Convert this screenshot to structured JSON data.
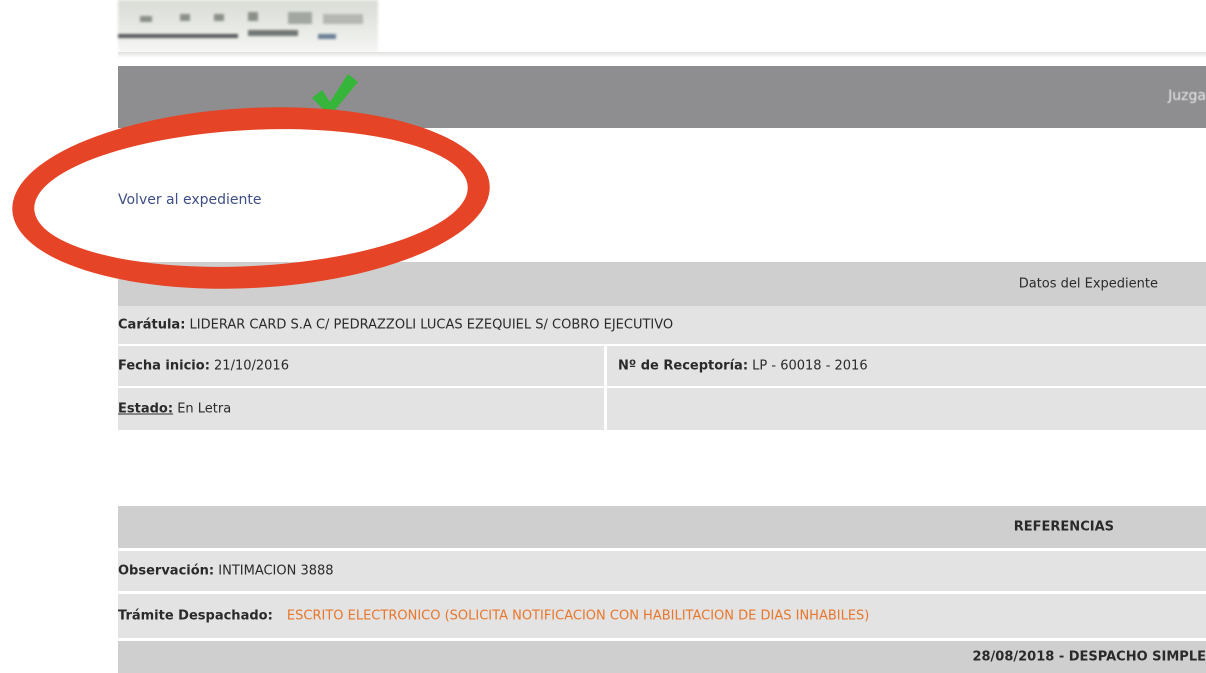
{
  "header": {
    "top_bar_text": "Juzga"
  },
  "nav": {
    "back_link": "Volver al expediente"
  },
  "expediente": {
    "section_title": "Datos del Expediente",
    "caratula_label": "Carátula:",
    "caratula_value": "LIDERAR CARD S.A C/ PEDRAZZOLI LUCAS EZEQUIEL S/ COBRO EJECUTIVO",
    "fecha_label": "Fecha inicio:",
    "fecha_value": "21/10/2016",
    "receptoria_label": "Nº de Receptoría:",
    "receptoria_value": "LP - 60018 - 2016",
    "estado_label": "Estado:",
    "estado_value": "En Letra"
  },
  "referencias": {
    "section_title": "REFERENCIAS",
    "observacion_label": "Observación:",
    "observacion_value": "INTIMACION 3888",
    "tramite_label": "Trámite Despachado:",
    "tramite_value": "ESCRITO ELECTRONICO (SOLICITA NOTIFICACION CON HABILITACION DE DIAS INHABILES)",
    "despacho_header": "28/08/2018 - DESPACHO SIMPLE"
  },
  "colors": {
    "header_bar": "#8e8e90",
    "section_header": "#cfcfcf",
    "row_bg": "#e3e3e3",
    "link": "#3f4f86",
    "highlight_ellipse": "#e64427",
    "tramite_text": "#e8772b",
    "check": "#35b53a"
  },
  "icons": [
    "check-icon"
  ]
}
